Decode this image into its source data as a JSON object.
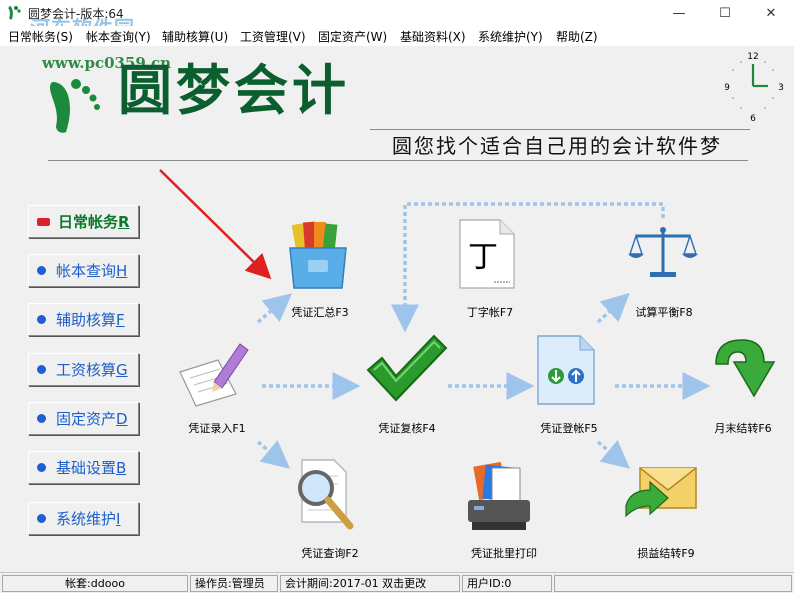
{
  "window": {
    "title": "圆梦会计-版本:64",
    "watermark": "河东软件园",
    "controls": {
      "minimize": "—",
      "maximize": "☐",
      "close": "✕"
    }
  },
  "menu": [
    {
      "label": "日常帐务(S)"
    },
    {
      "label": "帐本查询(Y)"
    },
    {
      "label": "辅助核算(U)"
    },
    {
      "label": "工资管理(V)"
    },
    {
      "label": "固定资产(W)"
    },
    {
      "label": "基础资料(X)"
    },
    {
      "label": "系统维护(Y)"
    },
    {
      "label": "帮助(Z)"
    }
  ],
  "banner": {
    "url": "www.pc0359.cn",
    "logo": "圆梦会计",
    "slogan": "圆您找个适合自己用的会计软件梦"
  },
  "clock": {
    "n12": "12",
    "n3": "3",
    "n6": "6",
    "n9": "9"
  },
  "sidebar": [
    {
      "label": "日常帐务",
      "key": "R",
      "active": true
    },
    {
      "label": "帐本查询",
      "key": "H"
    },
    {
      "label": "辅助核算",
      "key": "F"
    },
    {
      "label": "工资核算",
      "key": "G"
    },
    {
      "label": "固定资产",
      "key": "D"
    },
    {
      "label": "基础设置",
      "key": "B"
    },
    {
      "label": "系统维护",
      "key": "I"
    }
  ],
  "functions": {
    "voucher_entry": "凭证录入F1",
    "voucher_summary": "凭证汇总F3",
    "voucher_review": "凭证复核F4",
    "t_account": "丁字帐F7",
    "trial_balance": "试算平衡F8",
    "voucher_posting": "凭证登帐F5",
    "month_end": "月末结转F6",
    "voucher_query": "凭证查询F2",
    "batch_print": "凭证批里打印",
    "pl_transfer": "损益结转F9",
    "t_glyph": "丁"
  },
  "colors": {
    "accent": "#1c5fc9",
    "logo": "#0b5e2e",
    "active": "#0b7a2b",
    "arrow": "#9ec4ec"
  },
  "status": {
    "account": "帐套:ddooo",
    "operator": "操作员:管理员",
    "period": "会计期间:2017-01 双击更改",
    "user_id": "用户ID:0"
  }
}
